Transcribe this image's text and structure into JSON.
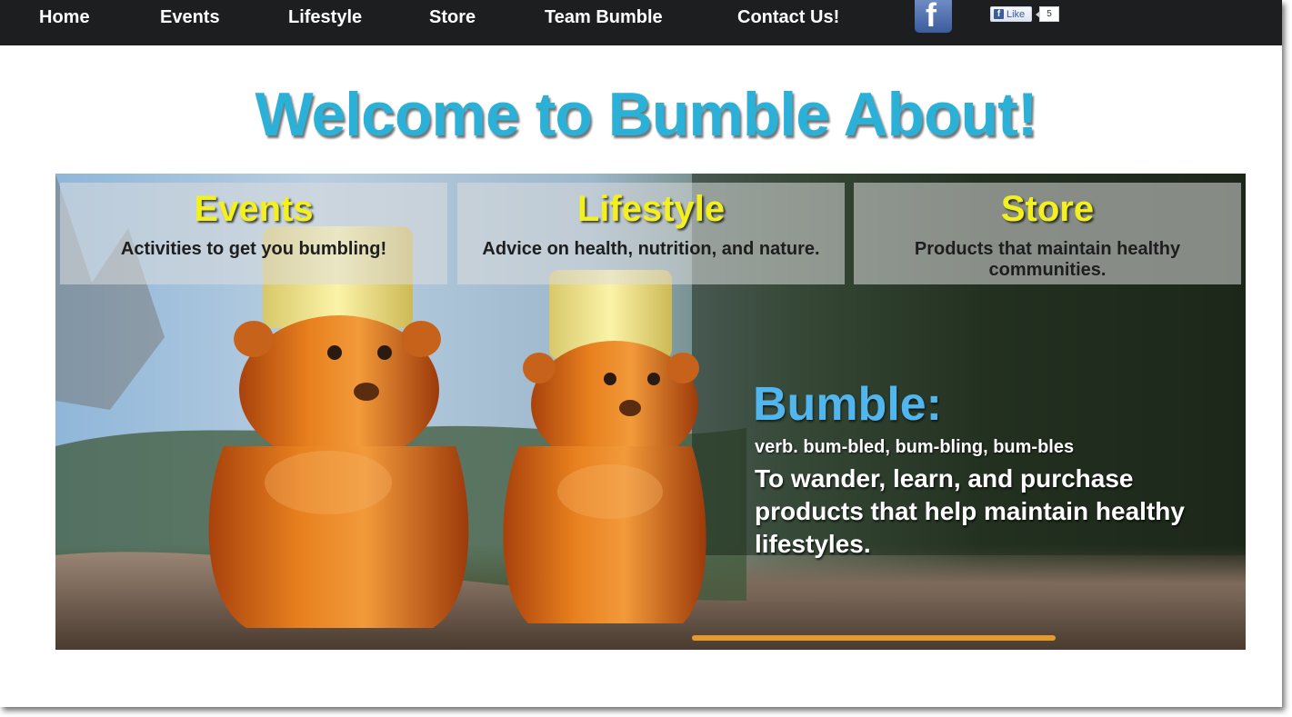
{
  "nav": {
    "items": [
      {
        "label": "Home"
      },
      {
        "label": "Events"
      },
      {
        "label": "Lifestyle"
      },
      {
        "label": "Store"
      },
      {
        "label": "Team Bumble"
      },
      {
        "label": "Contact Us!"
      }
    ],
    "facebook_icon": "facebook-icon",
    "like_button": {
      "label": "Like",
      "count": "5"
    }
  },
  "headline": "Welcome to Bumble About!",
  "hero": {
    "panels": [
      {
        "title": "Events",
        "description": "Activities to get you bumbling!"
      },
      {
        "title": "Lifestyle",
        "description": "Advice on health, nutrition, and nature."
      },
      {
        "title": "Store",
        "description": "Products that maintain healthy communities."
      }
    ],
    "definition": {
      "word": "Bumble:",
      "pronunciation": "verb. bum-bled, bum-bling, bum-bles",
      "meaning": "To wander, learn, and purchase products that help maintain healthy lifestyles."
    }
  },
  "colors": {
    "navbar": "#1c1e1f",
    "headline": "#2bb0d8",
    "panel_title": "#f3f021",
    "bumble_word": "#51b6ee",
    "honey": "#e0701a",
    "cap": "#f2e78a"
  }
}
